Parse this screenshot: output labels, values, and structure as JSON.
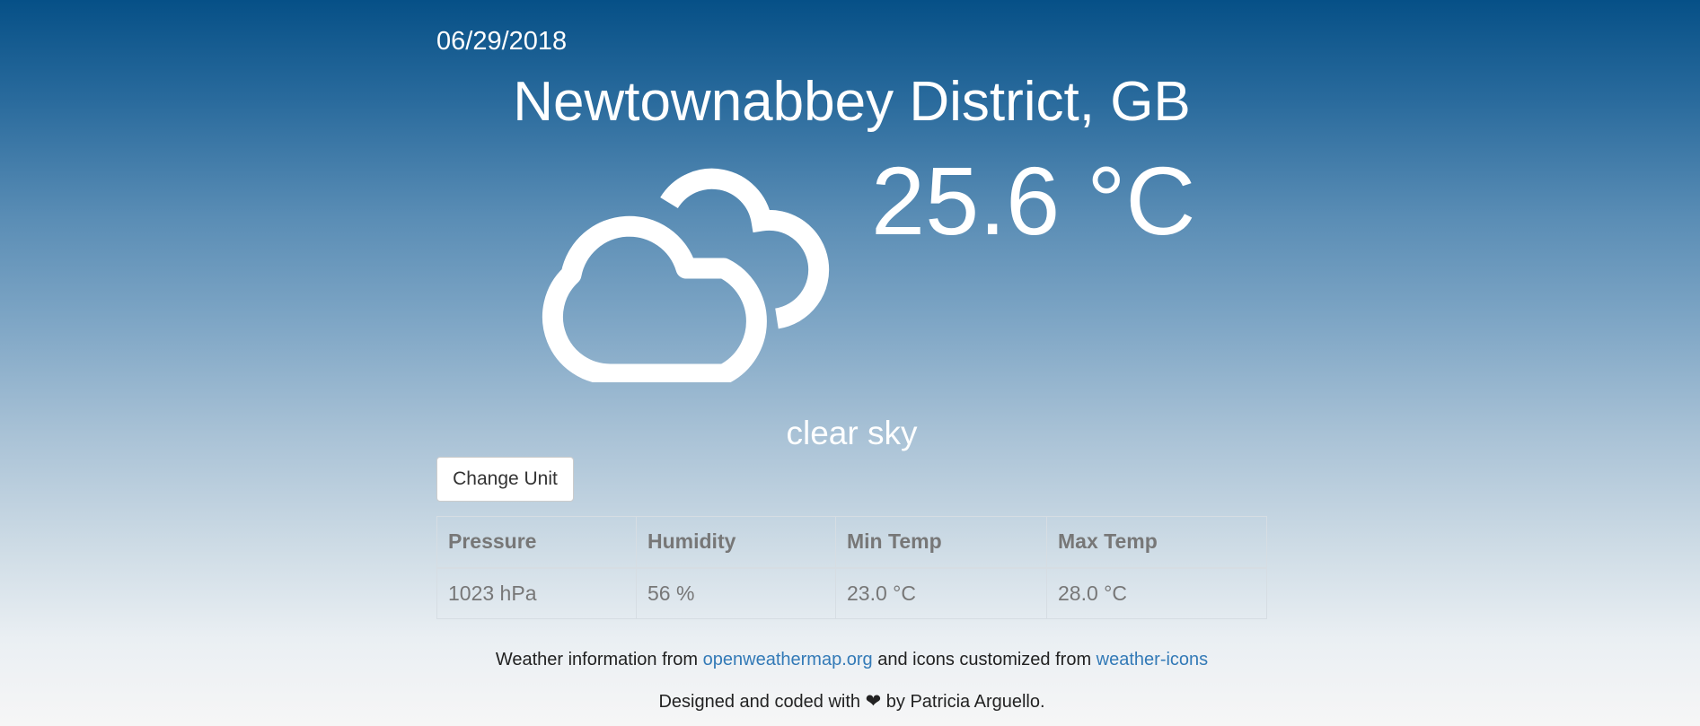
{
  "date": "06/29/2018",
  "location": "Newtownabbey District, GB",
  "temperature": "25.6 °C",
  "icon": "partly-cloudy-icon",
  "description": "clear sky",
  "change_unit_label": "Change Unit",
  "table": {
    "headers": [
      "Pressure",
      "Humidity",
      "Min Temp",
      "Max Temp"
    ],
    "values": [
      "1023 hPa",
      "56 %",
      "23.0 °C",
      "28.0 °C"
    ]
  },
  "footer": {
    "line1_prefix": "Weather information from ",
    "link1": "openweathermap.org",
    "line1_middle": " and icons customized from ",
    "link2": "weather-icons",
    "line2_prefix": "Designed and coded with ",
    "heart_icon": "heart-icon",
    "line2_suffix": " by Patricia Arguello."
  },
  "colors": {
    "gradient_top": "#065087",
    "gradient_bottom": "#f6f6f6",
    "link": "#337ab7",
    "table_text": "#777777"
  }
}
